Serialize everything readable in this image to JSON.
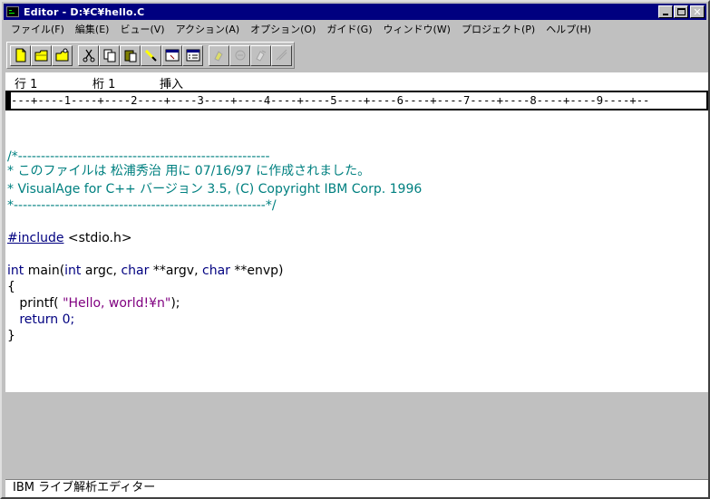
{
  "window": {
    "title": "Editor - D:¥C¥hello.C",
    "minimize_glyph": "",
    "close_glyph": "✕"
  },
  "menu": [
    {
      "label": "ファイル(F)",
      "name": "menu-file"
    },
    {
      "label": "編集(E)",
      "name": "menu-edit"
    },
    {
      "label": "ビュー(V)",
      "name": "menu-view"
    },
    {
      "label": "アクション(A)",
      "name": "menu-action"
    },
    {
      "label": "オプション(O)",
      "name": "menu-options"
    },
    {
      "label": "ガイド(G)",
      "name": "menu-guide"
    },
    {
      "label": "ウィンドウ(W)",
      "name": "menu-window"
    },
    {
      "label": "プロジェクト(P)",
      "name": "menu-project"
    },
    {
      "label": "ヘルプ(H)",
      "name": "menu-help"
    }
  ],
  "toolbar": {
    "icons": [
      "new-file-icon",
      "open-folder-icon",
      "open-project-icon",
      "cut-icon",
      "copy-icon",
      "paste-icon",
      "find-icon",
      "window-icon",
      "list-icon",
      "bookmark-icon",
      "bookmark2-icon",
      "bookmark3-icon",
      "bookmark4-icon"
    ]
  },
  "status_top": {
    "line_label": "行 1",
    "column_label": "桁 1",
    "mode": "挿入"
  },
  "ruler": {
    "text": "---+----1----+----2----+----3----+----4----+----5----+----6----+----7----+----8----+----9----+--"
  },
  "code": {
    "line1": "/*-------------------------------------------------------",
    "line2": "* このファイルは 松浦秀治 用に 07/16/97 に作成されました。",
    "line3": "* VisualAge for C++ バージョン 3.5, (C) Copyright IBM Corp. 1996",
    "line4": "*-------------------------------------------------------*/",
    "include_kw": "#include",
    "include_file": " <stdio.h>",
    "main_int": "int",
    "main_sig1": " main(",
    "main_int2": "int",
    "main_argc": " argc, ",
    "main_char1": "char",
    "main_argv": " **argv, ",
    "main_char2": "char",
    "main_envp": " **envp)",
    "brace_open": "{",
    "printf_call": "   printf( ",
    "printf_str": "\"Hello, world!¥n\"",
    "printf_end": ");",
    "return_stmt": "   return 0;",
    "brace_close": "}"
  },
  "status_bottom": {
    "text": "IBM ライブ解析エディター"
  },
  "colors": {
    "titlebar": "#000080",
    "comment": "#008080",
    "keyword": "#000080",
    "string": "#800080"
  }
}
